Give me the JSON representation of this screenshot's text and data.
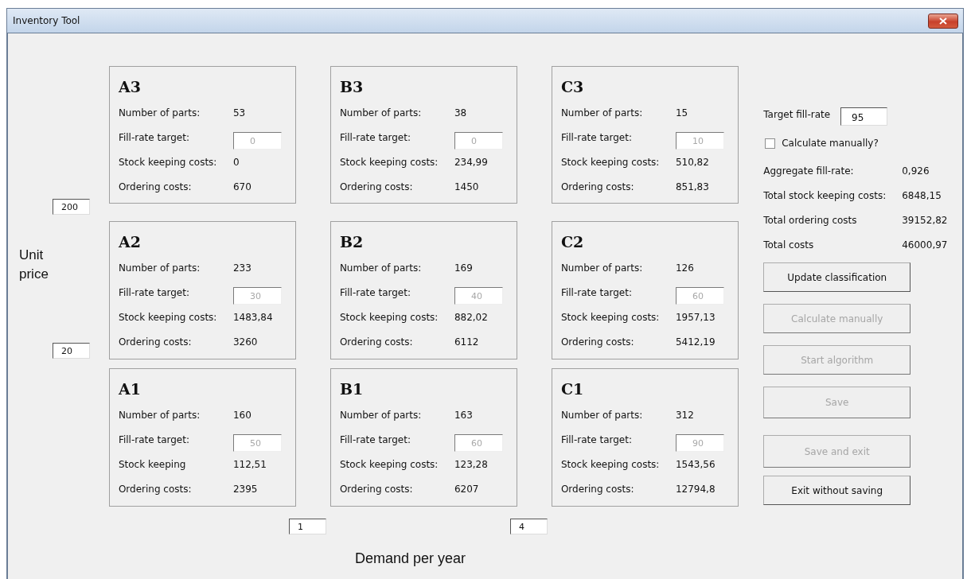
{
  "window": {
    "title": "Inventory Tool"
  },
  "price_axis": {
    "label": "Unit price",
    "thresholds": [
      "200",
      "20"
    ]
  },
  "demand_axis": {
    "label": "Demand per year",
    "thresholds": [
      "1",
      "4"
    ]
  },
  "panels": [
    {
      "name": "A3",
      "rows": [
        {
          "kind": "text",
          "label": "Number of parts:",
          "value": "53"
        },
        {
          "kind": "input",
          "label": "Fill-rate target:",
          "value": "0",
          "disabled": true
        },
        {
          "kind": "text",
          "label": "Stock keeping costs:",
          "value": "0"
        },
        {
          "kind": "text",
          "label": "Ordering costs:",
          "value": "670"
        }
      ]
    },
    {
      "name": "B3",
      "rows": [
        {
          "kind": "text",
          "label": "Number of parts:",
          "value": "38"
        },
        {
          "kind": "input",
          "label": "Fill-rate target:",
          "value": "0",
          "disabled": true
        },
        {
          "kind": "text",
          "label": "Stock keeping costs:",
          "value": "234,99"
        },
        {
          "kind": "text",
          "label": "Ordering costs:",
          "value": "1450"
        }
      ]
    },
    {
      "name": "C3",
      "rows": [
        {
          "kind": "text",
          "label": "Number of parts:",
          "value": "15"
        },
        {
          "kind": "input",
          "label": "Fill-rate target:",
          "value": "10",
          "disabled": true
        },
        {
          "kind": "text",
          "label": "Stock keeping costs:",
          "value": "510,82"
        },
        {
          "kind": "text",
          "label": "Ordering costs:",
          "value": "851,83"
        }
      ]
    },
    {
      "name": "A2",
      "rows": [
        {
          "kind": "text",
          "label": "Number of parts:",
          "value": "233"
        },
        {
          "kind": "input",
          "label": "Fill-rate target:",
          "value": "30",
          "disabled": true
        },
        {
          "kind": "text",
          "label": "Stock keeping costs:",
          "value": "1483,84"
        },
        {
          "kind": "text",
          "label": "Ordering costs:",
          "value": "3260"
        }
      ]
    },
    {
      "name": "B2",
      "rows": [
        {
          "kind": "text",
          "label": "Number of parts:",
          "value": "169"
        },
        {
          "kind": "input",
          "label": "Fill-rate target:",
          "value": "40",
          "disabled": true
        },
        {
          "kind": "text",
          "label": "Stock keeping costs:",
          "value": "882,02"
        },
        {
          "kind": "text",
          "label": "Ordering costs:",
          "value": "6112"
        }
      ]
    },
    {
      "name": "C2",
      "rows": [
        {
          "kind": "text",
          "label": "Number of parts:",
          "value": "126"
        },
        {
          "kind": "input",
          "label": "Fill-rate target:",
          "value": "60",
          "disabled": true
        },
        {
          "kind": "text",
          "label": "Stock keeping costs:",
          "value": "1957,13"
        },
        {
          "kind": "text",
          "label": "Ordering costs:",
          "value": "5412,19"
        }
      ]
    },
    {
      "name": "A1",
      "rows": [
        {
          "kind": "text",
          "label": "Number of parts:",
          "value": "160"
        },
        {
          "kind": "input",
          "label": "Fill-rate target:",
          "value": "50",
          "disabled": true
        },
        {
          "kind": "text",
          "label": "Stock keeping",
          "value": "112,51"
        },
        {
          "kind": "text",
          "label": "Ordering costs:",
          "value": "2395"
        }
      ]
    },
    {
      "name": "B1",
      "rows": [
        {
          "kind": "text",
          "label": "Number of parts:",
          "value": "163"
        },
        {
          "kind": "input",
          "label": "Fill-rate target:",
          "value": "60",
          "disabled": true
        },
        {
          "kind": "text",
          "label": "Stock keeping costs:",
          "value": "123,28"
        },
        {
          "kind": "text",
          "label": "Ordering costs:",
          "value": "6207"
        }
      ]
    },
    {
      "name": "C1",
      "rows": [
        {
          "kind": "text",
          "label": "Number of parts:",
          "value": "312"
        },
        {
          "kind": "input",
          "label": "Fill-rate target:",
          "value": "90",
          "disabled": true
        },
        {
          "kind": "text",
          "label": "Stock keeping costs:",
          "value": "1543,56"
        },
        {
          "kind": "text",
          "label": "Ordering costs:",
          "value": "12794,8"
        }
      ]
    }
  ],
  "sidebar": {
    "target": {
      "label": "Target fill-rate",
      "value": "95"
    },
    "manual_checkbox": {
      "label": "Calculate manually?",
      "checked": false
    },
    "totals": [
      {
        "label": "Aggregate fill-rate:",
        "value": "0,926"
      },
      {
        "label": "Total stock keeping costs:",
        "value": "6848,15"
      },
      {
        "label": "Total ordering costs",
        "value": "39152,82"
      },
      {
        "label": "Total costs",
        "value": "46000,97"
      }
    ],
    "buttons": [
      {
        "label": "Update classification",
        "disabled": false
      },
      {
        "label": "Calculate manually",
        "disabled": true
      },
      {
        "label": "Start algorithm",
        "disabled": true
      },
      {
        "label": "Save",
        "disabled": true
      },
      {
        "label": "Save and exit",
        "disabled": true
      },
      {
        "label": "Exit without saving",
        "disabled": false
      }
    ]
  }
}
